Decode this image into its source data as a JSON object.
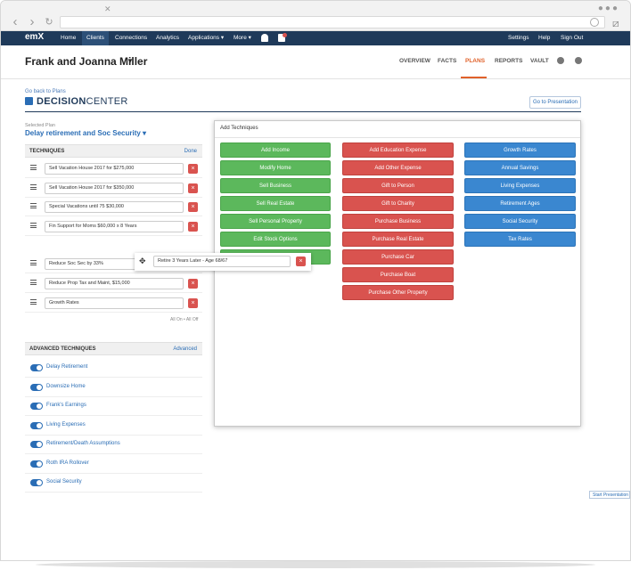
{
  "topnav": {
    "logo": "emX",
    "items": [
      "Home",
      "Clients",
      "Connections",
      "Analytics",
      "Applications ▾",
      "More ▾"
    ],
    "right_items": [
      "Settings",
      "Help",
      "Sign Out"
    ]
  },
  "header": {
    "client_name": "Frank and Joanna Miller",
    "tabs": [
      "OVERVIEW",
      "FACTS",
      "PLANS",
      "REPORTS",
      "VAULT"
    ],
    "active_tab": "PLANS"
  },
  "decision_center": {
    "back_link": "Go back to Plans",
    "title_part1": "DECISION",
    "title_part2": "CENTER",
    "present_button": "Go to Presentation"
  },
  "plan": {
    "selected_label": "Selected Plan",
    "selected_value": "Delay retirement and Soc Security ▾"
  },
  "techniques": {
    "header": "TECHNIQUES",
    "done": "Done",
    "rows": [
      "Sell Vacation House 2017 for $275,000",
      "Sell Vacation House 2017 for $350,000",
      "Special Vacations until 75 $30,000",
      "Fin Support for Moms $60,000 x 8 Years",
      "Reduce Soc Sec by 33%",
      "Reduce Prop Tax and Maint, $15,000",
      "Growth Rates"
    ],
    "all_toggle": "All On • All Off"
  },
  "advanced": {
    "header": "ADVANCED TECHNIQUES",
    "link": "Advanced",
    "items": [
      "Delay Retirement",
      "Downsize Home",
      "Frank's Earnings",
      "Living Expenses",
      "Retirement/Death Assumptions",
      "Roth IRA Rollover",
      "Social Security"
    ]
  },
  "modal": {
    "title": "Add Techniques",
    "green": [
      "Add Income",
      "Modify Home",
      "Sell Business",
      "Sell Real Estate",
      "Sell Personal Property",
      "Edit Stock Options"
    ],
    "red": [
      "Add Education Expense",
      "Add Other Expense",
      "Gift to Person",
      "Gift to Charity",
      "Purchase Business",
      "Purchase Real Estate",
      "Purchase Car",
      "Purchase Boat",
      "Purchase Other Property"
    ],
    "blue": [
      "Growth Rates",
      "Annual Savings",
      "Living Expenses",
      "Retirement Ages",
      "Social Security",
      "Tax Rates"
    ]
  },
  "drag_item": "Retire 3 Years Later - Age 68/67",
  "start_presentation": "Start Presentation",
  "delete_glyph": "×",
  "colors": {
    "nav_bg": "#1f3a5a",
    "accent": "#e0612a",
    "green": "#5cb85c",
    "red": "#d9534f",
    "blue": "#3a87d0"
  }
}
